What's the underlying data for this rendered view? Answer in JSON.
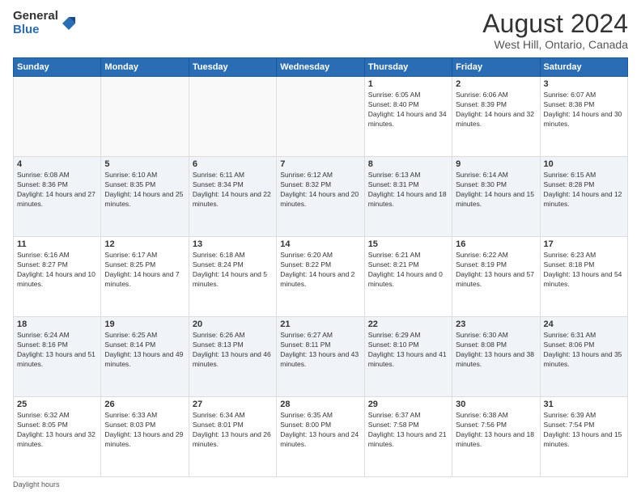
{
  "logo": {
    "general": "General",
    "blue": "Blue"
  },
  "header": {
    "title": "August 2024",
    "subtitle": "West Hill, Ontario, Canada"
  },
  "weekdays": [
    "Sunday",
    "Monday",
    "Tuesday",
    "Wednesday",
    "Thursday",
    "Friday",
    "Saturday"
  ],
  "legend": {
    "daylight": "Daylight hours"
  },
  "weeks": [
    [
      {
        "day": "",
        "empty": true
      },
      {
        "day": "",
        "empty": true
      },
      {
        "day": "",
        "empty": true
      },
      {
        "day": "",
        "empty": true
      },
      {
        "day": "1",
        "sunrise": "Sunrise: 6:05 AM",
        "sunset": "Sunset: 8:40 PM",
        "daylight": "Daylight: 14 hours and 34 minutes."
      },
      {
        "day": "2",
        "sunrise": "Sunrise: 6:06 AM",
        "sunset": "Sunset: 8:39 PM",
        "daylight": "Daylight: 14 hours and 32 minutes."
      },
      {
        "day": "3",
        "sunrise": "Sunrise: 6:07 AM",
        "sunset": "Sunset: 8:38 PM",
        "daylight": "Daylight: 14 hours and 30 minutes."
      }
    ],
    [
      {
        "day": "4",
        "sunrise": "Sunrise: 6:08 AM",
        "sunset": "Sunset: 8:36 PM",
        "daylight": "Daylight: 14 hours and 27 minutes."
      },
      {
        "day": "5",
        "sunrise": "Sunrise: 6:10 AM",
        "sunset": "Sunset: 8:35 PM",
        "daylight": "Daylight: 14 hours and 25 minutes."
      },
      {
        "day": "6",
        "sunrise": "Sunrise: 6:11 AM",
        "sunset": "Sunset: 8:34 PM",
        "daylight": "Daylight: 14 hours and 22 minutes."
      },
      {
        "day": "7",
        "sunrise": "Sunrise: 6:12 AM",
        "sunset": "Sunset: 8:32 PM",
        "daylight": "Daylight: 14 hours and 20 minutes."
      },
      {
        "day": "8",
        "sunrise": "Sunrise: 6:13 AM",
        "sunset": "Sunset: 8:31 PM",
        "daylight": "Daylight: 14 hours and 18 minutes."
      },
      {
        "day": "9",
        "sunrise": "Sunrise: 6:14 AM",
        "sunset": "Sunset: 8:30 PM",
        "daylight": "Daylight: 14 hours and 15 minutes."
      },
      {
        "day": "10",
        "sunrise": "Sunrise: 6:15 AM",
        "sunset": "Sunset: 8:28 PM",
        "daylight": "Daylight: 14 hours and 12 minutes."
      }
    ],
    [
      {
        "day": "11",
        "sunrise": "Sunrise: 6:16 AM",
        "sunset": "Sunset: 8:27 PM",
        "daylight": "Daylight: 14 hours and 10 minutes."
      },
      {
        "day": "12",
        "sunrise": "Sunrise: 6:17 AM",
        "sunset": "Sunset: 8:25 PM",
        "daylight": "Daylight: 14 hours and 7 minutes."
      },
      {
        "day": "13",
        "sunrise": "Sunrise: 6:18 AM",
        "sunset": "Sunset: 8:24 PM",
        "daylight": "Daylight: 14 hours and 5 minutes."
      },
      {
        "day": "14",
        "sunrise": "Sunrise: 6:20 AM",
        "sunset": "Sunset: 8:22 PM",
        "daylight": "Daylight: 14 hours and 2 minutes."
      },
      {
        "day": "15",
        "sunrise": "Sunrise: 6:21 AM",
        "sunset": "Sunset: 8:21 PM",
        "daylight": "Daylight: 14 hours and 0 minutes."
      },
      {
        "day": "16",
        "sunrise": "Sunrise: 6:22 AM",
        "sunset": "Sunset: 8:19 PM",
        "daylight": "Daylight: 13 hours and 57 minutes."
      },
      {
        "day": "17",
        "sunrise": "Sunrise: 6:23 AM",
        "sunset": "Sunset: 8:18 PM",
        "daylight": "Daylight: 13 hours and 54 minutes."
      }
    ],
    [
      {
        "day": "18",
        "sunrise": "Sunrise: 6:24 AM",
        "sunset": "Sunset: 8:16 PM",
        "daylight": "Daylight: 13 hours and 51 minutes."
      },
      {
        "day": "19",
        "sunrise": "Sunrise: 6:25 AM",
        "sunset": "Sunset: 8:14 PM",
        "daylight": "Daylight: 13 hours and 49 minutes."
      },
      {
        "day": "20",
        "sunrise": "Sunrise: 6:26 AM",
        "sunset": "Sunset: 8:13 PM",
        "daylight": "Daylight: 13 hours and 46 minutes."
      },
      {
        "day": "21",
        "sunrise": "Sunrise: 6:27 AM",
        "sunset": "Sunset: 8:11 PM",
        "daylight": "Daylight: 13 hours and 43 minutes."
      },
      {
        "day": "22",
        "sunrise": "Sunrise: 6:29 AM",
        "sunset": "Sunset: 8:10 PM",
        "daylight": "Daylight: 13 hours and 41 minutes."
      },
      {
        "day": "23",
        "sunrise": "Sunrise: 6:30 AM",
        "sunset": "Sunset: 8:08 PM",
        "daylight": "Daylight: 13 hours and 38 minutes."
      },
      {
        "day": "24",
        "sunrise": "Sunrise: 6:31 AM",
        "sunset": "Sunset: 8:06 PM",
        "daylight": "Daylight: 13 hours and 35 minutes."
      }
    ],
    [
      {
        "day": "25",
        "sunrise": "Sunrise: 6:32 AM",
        "sunset": "Sunset: 8:05 PM",
        "daylight": "Daylight: 13 hours and 32 minutes."
      },
      {
        "day": "26",
        "sunrise": "Sunrise: 6:33 AM",
        "sunset": "Sunset: 8:03 PM",
        "daylight": "Daylight: 13 hours and 29 minutes."
      },
      {
        "day": "27",
        "sunrise": "Sunrise: 6:34 AM",
        "sunset": "Sunset: 8:01 PM",
        "daylight": "Daylight: 13 hours and 26 minutes."
      },
      {
        "day": "28",
        "sunrise": "Sunrise: 6:35 AM",
        "sunset": "Sunset: 8:00 PM",
        "daylight": "Daylight: 13 hours and 24 minutes."
      },
      {
        "day": "29",
        "sunrise": "Sunrise: 6:37 AM",
        "sunset": "Sunset: 7:58 PM",
        "daylight": "Daylight: 13 hours and 21 minutes."
      },
      {
        "day": "30",
        "sunrise": "Sunrise: 6:38 AM",
        "sunset": "Sunset: 7:56 PM",
        "daylight": "Daylight: 13 hours and 18 minutes."
      },
      {
        "day": "31",
        "sunrise": "Sunrise: 6:39 AM",
        "sunset": "Sunset: 7:54 PM",
        "daylight": "Daylight: 13 hours and 15 minutes."
      }
    ]
  ]
}
